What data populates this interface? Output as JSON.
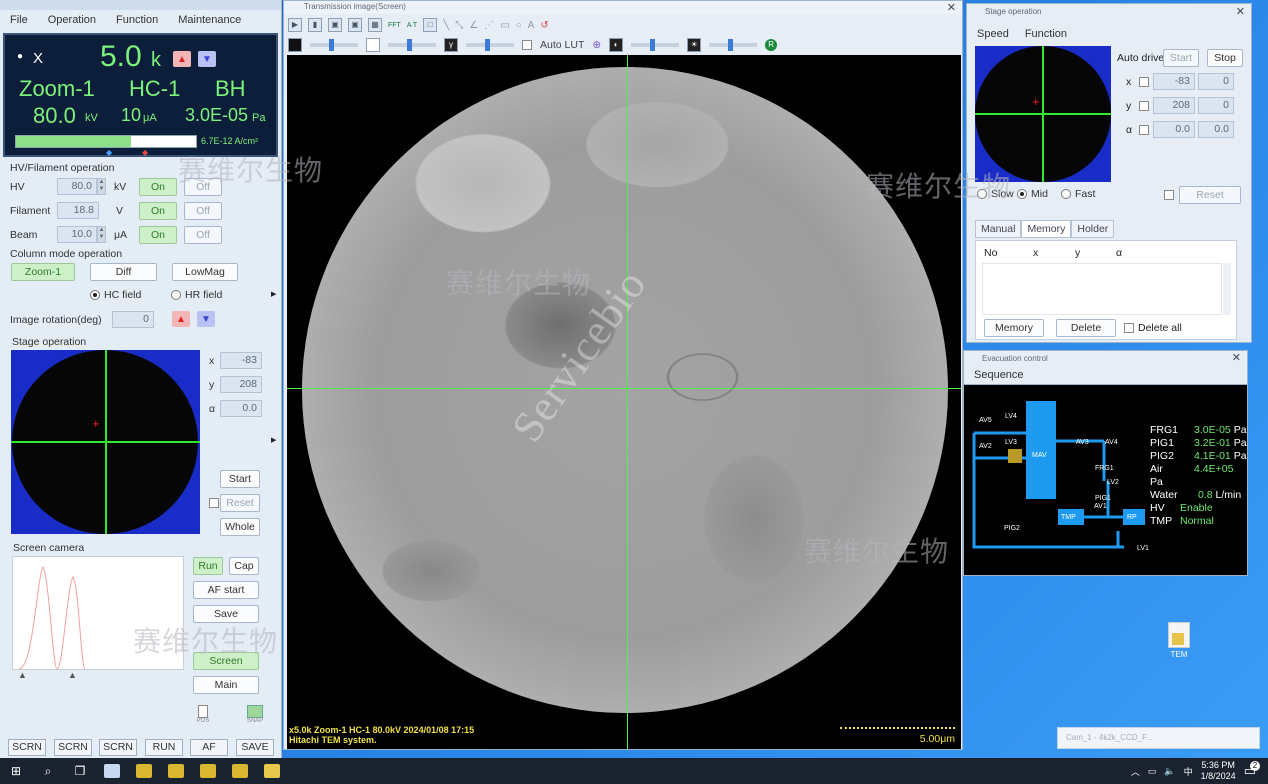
{
  "left_panel": {
    "menu": [
      "File",
      "Operation",
      "Function",
      "Maintenance"
    ],
    "lcd": {
      "bullet": "●",
      "mag_prefix": "X",
      "mag_value": "5.0",
      "mag_unit": "k",
      "mode": "Zoom-1",
      "lens": "HC-1",
      "gun": "BH",
      "kv_value": "80.0",
      "kv_unit": "kV",
      "current_value": "10",
      "current_unit": "μA",
      "pressure_value": "3.0E-05",
      "pressure_unit": "Pa",
      "density": "6.7E-12 A/cm²",
      "density_fill_fraction": 0.64
    },
    "hv_section": {
      "title": "HV/Filament operation",
      "rows": [
        {
          "label": "HV",
          "value": "80.0",
          "unit": "kV",
          "on": "On",
          "off": "Off"
        },
        {
          "label": "Filament",
          "value": "18.8",
          "unit": "V",
          "on": "On",
          "off": "Off"
        },
        {
          "label": "Beam",
          "value": "10.0",
          "unit": "μA",
          "on": "On",
          "off": "Off"
        }
      ]
    },
    "column_section": {
      "title": "Column mode operation",
      "zoom": "Zoom-1",
      "diff": "Diff",
      "lowmag": "LowMag",
      "hc_field": "HC field",
      "hr_field": "HR field",
      "rotation_label": "Image rotation(deg)",
      "rotation_value": "0"
    },
    "stage_section": {
      "title": "Stage operation",
      "x_label": "x",
      "x_value": "-83",
      "y_label": "y",
      "y_value": "208",
      "a_label": "α",
      "a_value": "0.0",
      "start": "Start",
      "reset": "Reset",
      "whole": "Whole"
    },
    "camera_section": {
      "title": "Screen camera",
      "run": "Run",
      "cap": "Cap",
      "af_start": "AF start",
      "save": "Save",
      "screen": "Screen",
      "main": "Main"
    },
    "bottom_buttons": [
      "SCRN",
      "SCRN",
      "SCRN",
      "RUN",
      "AF",
      "SAVE"
    ],
    "lower_icons": [
      "POS",
      "SNAP"
    ]
  },
  "image_window": {
    "title": "Transmission image(Screen)",
    "toolbar_labels": [
      "FFT",
      "A T"
    ],
    "auto_lut": "Auto LUT",
    "info_line1": "x5.0k Zoom-1 HC-1 80.0kV 2024/01/08 17:15",
    "info_line2": "Hitachi TEM system.",
    "scale_text": "5.00μm",
    "crosshair_color": "#4cf24c"
  },
  "stage_window": {
    "title": "Stage operation",
    "menu": [
      "Speed",
      "Function"
    ],
    "auto_drive": "Auto drive",
    "start": "Start",
    "stop": "Stop",
    "axes": [
      {
        "label": "x",
        "value": "-83",
        "target": "0"
      },
      {
        "label": "y",
        "value": "208",
        "target": "0"
      },
      {
        "label": "α",
        "value": "0.0",
        "target": "0.0"
      }
    ],
    "speed_slow": "Slow",
    "speed_mid": "Mid",
    "speed_fast": "Fast",
    "reset": "Reset",
    "tabs": [
      "Manual",
      "Memory",
      "Holder"
    ],
    "list_headers": [
      "No",
      "x",
      "y",
      "α"
    ],
    "memory_btn": "Memory",
    "delete_btn": "Delete",
    "delete_all": "Delete all"
  },
  "evac_window": {
    "title": "Evacuation control",
    "sequence": "Sequence",
    "readings": [
      {
        "k": "FRG1",
        "v": "3.0E-05",
        "u": "Pa"
      },
      {
        "k": "PIG1",
        "v": "3.2E-01",
        "u": "Pa"
      },
      {
        "k": "PIG2",
        "v": "4.1E-01",
        "u": "Pa"
      },
      {
        "k": "Air",
        "v": "4.4E+05",
        "u": "Pa"
      }
    ],
    "water_label": "Water",
    "water_value": "0.8",
    "water_unit": "L/min",
    "hv_label": "HV",
    "hv_value": "Enable",
    "tmp_label": "TMP",
    "tmp_value": "Normal",
    "valves": [
      "AV5",
      "LV4",
      "AV2",
      "LV3",
      "AV3",
      "AV4",
      "FRG1",
      "LV2",
      "PIG1",
      "AV1",
      "LV1",
      "PIG2",
      "MAV",
      "TMP",
      "RP"
    ]
  },
  "desktop": {
    "icon_label": "TEM",
    "notification": "Cam_1 - 4k2k_CCD_F..."
  },
  "taskbar": {
    "time": "5:36 PM",
    "date": "1/8/2024",
    "notify_count": "2"
  },
  "watermarks": [
    "赛维尔生物",
    "赛维尔生物",
    "赛维尔生物",
    "赛维尔生物",
    "赛维尔生物",
    "Servicebio"
  ]
}
